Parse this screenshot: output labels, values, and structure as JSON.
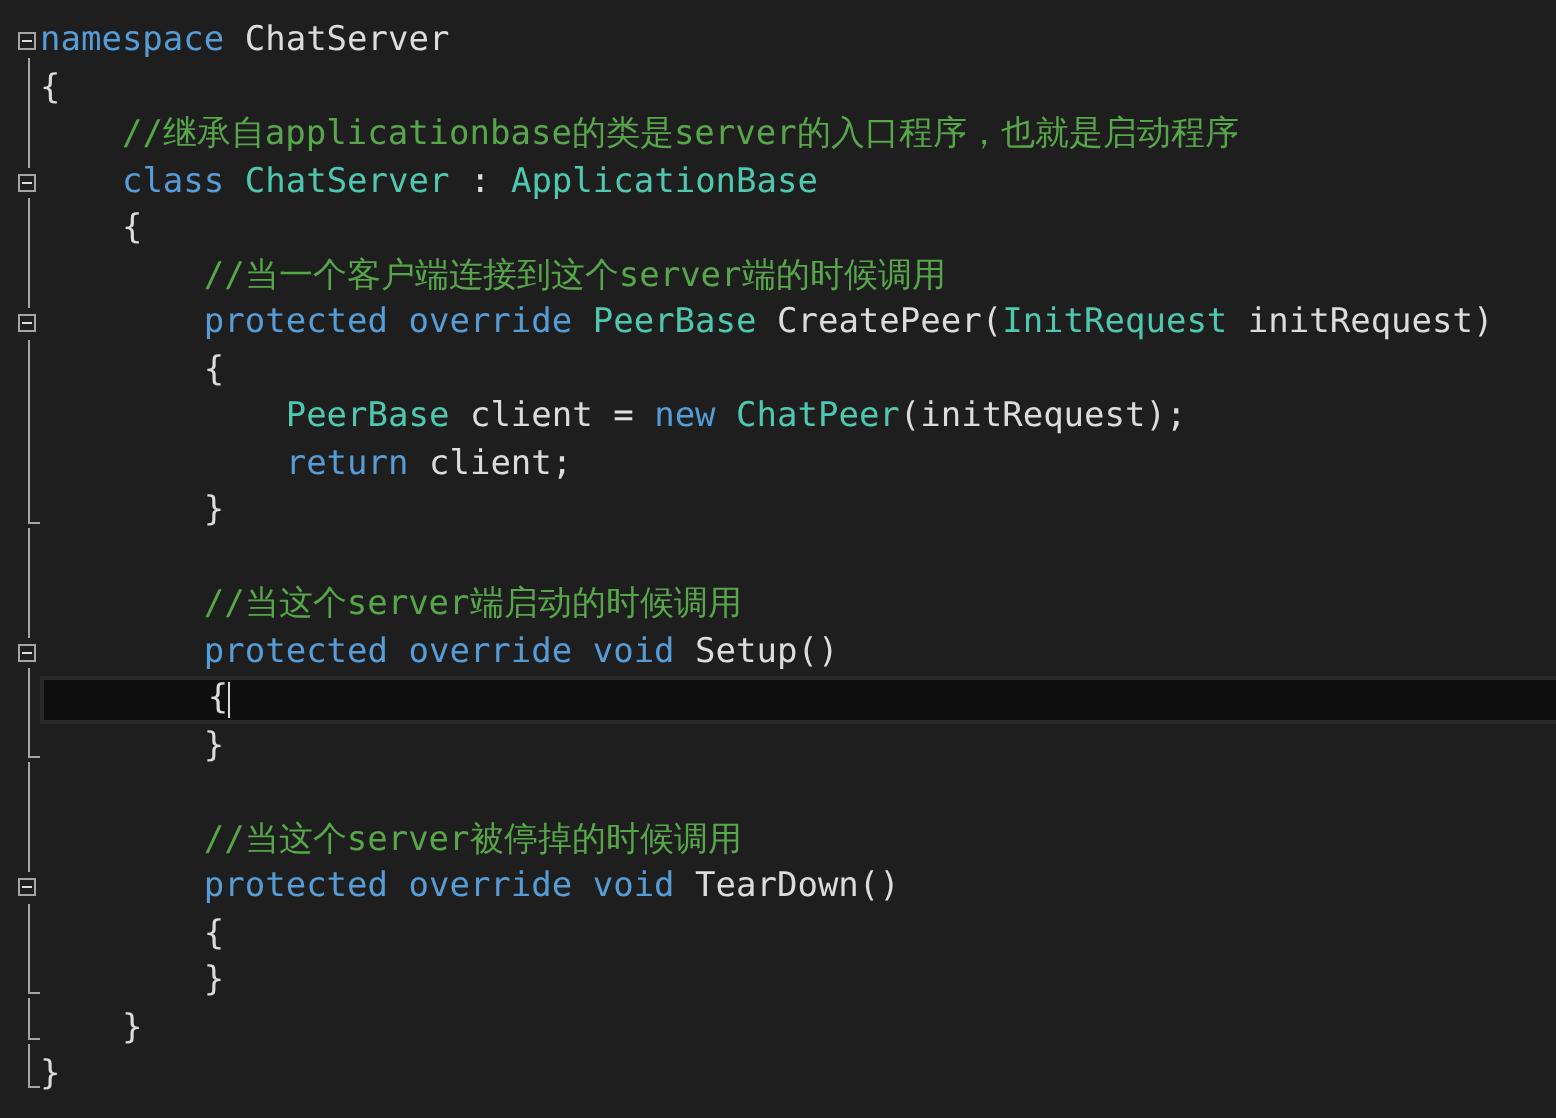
{
  "editor": {
    "lines": [
      {
        "kind": "code",
        "expanded": true,
        "tokens": [
          {
            "kind": "keyword",
            "text": "namespace"
          },
          {
            "kind": "plain",
            "text": " ChatServer"
          }
        ]
      },
      {
        "kind": "code",
        "tokens": [
          {
            "kind": "plain",
            "text": "{"
          }
        ]
      },
      {
        "kind": "code",
        "tokens": [
          {
            "kind": "comment",
            "text": "    //继承自applicationbase的类是server的入口程序，也就是启动程序"
          }
        ]
      },
      {
        "kind": "code",
        "expanded": true,
        "tokens": [
          {
            "kind": "keyword",
            "text": "    class"
          },
          {
            "kind": "type",
            "text": " ChatServer"
          },
          {
            "kind": "plain",
            "text": " : "
          },
          {
            "kind": "type",
            "text": "ApplicationBase"
          }
        ]
      },
      {
        "kind": "code",
        "tokens": [
          {
            "kind": "plain",
            "text": "    {"
          }
        ]
      },
      {
        "kind": "code",
        "tokens": [
          {
            "kind": "comment",
            "text": "        //当一个客户端连接到这个server端的时候调用"
          }
        ]
      },
      {
        "kind": "code",
        "expanded": true,
        "tokens": [
          {
            "kind": "keyword",
            "text": "        protected override"
          },
          {
            "kind": "type",
            "text": " PeerBase"
          },
          {
            "kind": "plain",
            "text": " CreatePeer("
          },
          {
            "kind": "type",
            "text": "InitRequest"
          },
          {
            "kind": "plain",
            "text": " initRequest)"
          }
        ]
      },
      {
        "kind": "code",
        "tokens": [
          {
            "kind": "plain",
            "text": "        {"
          }
        ]
      },
      {
        "kind": "code",
        "tokens": [
          {
            "kind": "type",
            "text": "            PeerBase"
          },
          {
            "kind": "plain",
            "text": " client = "
          },
          {
            "kind": "keyword",
            "text": "new"
          },
          {
            "kind": "type",
            "text": " ChatPeer"
          },
          {
            "kind": "plain",
            "text": "(initRequest);"
          }
        ]
      },
      {
        "kind": "code",
        "tokens": [
          {
            "kind": "keyword",
            "text": "            return"
          },
          {
            "kind": "plain",
            "text": " client;"
          }
        ]
      },
      {
        "kind": "code",
        "fold_end": true,
        "tokens": [
          {
            "kind": "plain",
            "text": "        }"
          }
        ]
      },
      {
        "kind": "blank"
      },
      {
        "kind": "code",
        "tokens": [
          {
            "kind": "comment",
            "text": "        //当这个server端启动的时候调用"
          }
        ]
      },
      {
        "kind": "code",
        "expanded": true,
        "tokens": [
          {
            "kind": "keyword",
            "text": "        protected override void"
          },
          {
            "kind": "plain",
            "text": " Setup()"
          }
        ]
      },
      {
        "kind": "code",
        "current": true,
        "tokens": [
          {
            "kind": "plain",
            "text": "        {"
          }
        ]
      },
      {
        "kind": "code",
        "fold_end": true,
        "tokens": [
          {
            "kind": "plain",
            "text": "        }"
          }
        ]
      },
      {
        "kind": "blank"
      },
      {
        "kind": "code",
        "tokens": [
          {
            "kind": "comment",
            "text": "        //当这个server被停掉的时候调用"
          }
        ]
      },
      {
        "kind": "code",
        "expanded": true,
        "tokens": [
          {
            "kind": "keyword",
            "text": "        protected override void"
          },
          {
            "kind": "plain",
            "text": " TearDown()"
          }
        ]
      },
      {
        "kind": "code",
        "tokens": [
          {
            "kind": "plain",
            "text": "        {"
          }
        ]
      },
      {
        "kind": "code",
        "fold_end": true,
        "tokens": [
          {
            "kind": "plain",
            "text": "        }"
          }
        ]
      },
      {
        "kind": "code",
        "fold_end": true,
        "tokens": [
          {
            "kind": "plain",
            "text": "    }"
          }
        ]
      },
      {
        "kind": "code",
        "fold_end": true,
        "tokens": [
          {
            "kind": "plain",
            "text": "}"
          }
        ]
      }
    ]
  }
}
